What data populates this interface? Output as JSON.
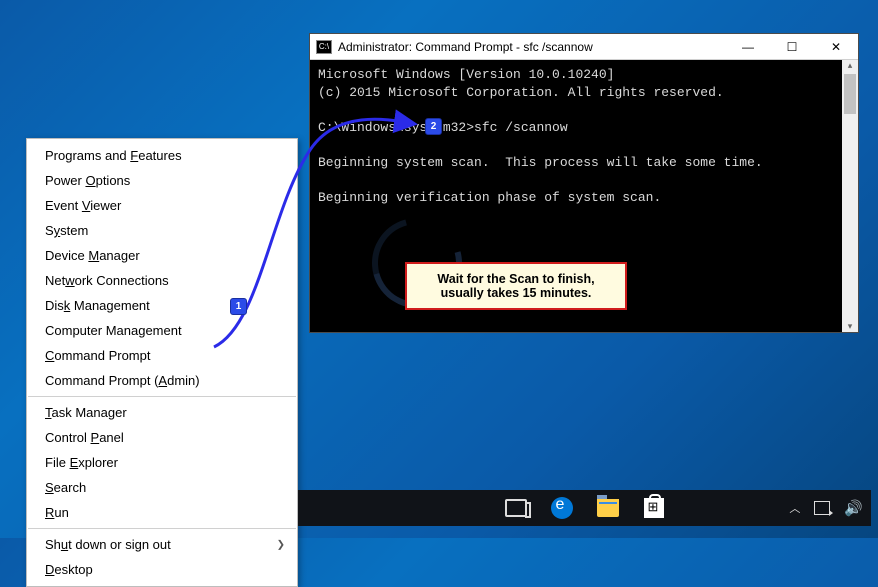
{
  "context_menu": {
    "items": [
      {
        "label_pre": "Programs and ",
        "u": "F",
        "label_post": "eatures"
      },
      {
        "label_pre": "Power ",
        "u": "O",
        "label_post": "ptions"
      },
      {
        "label_pre": "Event ",
        "u": "V",
        "label_post": "iewer"
      },
      {
        "label_pre": "S",
        "u": "y",
        "label_post": "stem"
      },
      {
        "label_pre": "Device ",
        "u": "M",
        "label_post": "anager"
      },
      {
        "label_pre": "Net",
        "u": "w",
        "label_post": "ork Connections"
      },
      {
        "label_pre": "Dis",
        "u": "k",
        "label_post": " Management"
      },
      {
        "label_pre": "Computer Mana",
        "u": "g",
        "label_post": "ement"
      },
      {
        "label_pre": "",
        "u": "C",
        "label_post": "ommand Prompt"
      },
      {
        "label_pre": "Command Prompt (",
        "u": "A",
        "label_post": "dmin)"
      }
    ],
    "items2": [
      {
        "label_pre": "",
        "u": "T",
        "label_post": "ask Manager"
      },
      {
        "label_pre": "Control ",
        "u": "P",
        "label_post": "anel"
      },
      {
        "label_pre": "File ",
        "u": "E",
        "label_post": "xplorer"
      },
      {
        "label_pre": "",
        "u": "S",
        "label_post": "earch"
      },
      {
        "label_pre": "",
        "u": "R",
        "label_post": "un"
      }
    ],
    "items3": [
      {
        "label_pre": "Sh",
        "u": "u",
        "label_post": "t down or sign out",
        "arrow": true
      },
      {
        "label_pre": "",
        "u": "D",
        "label_post": "esktop"
      }
    ]
  },
  "cmd": {
    "title": "Administrator: Command Prompt - sfc  /scannow",
    "line1": "Microsoft Windows [Version 10.0.10240]",
    "line2": "(c) 2015 Microsoft Corporation. All rights reserved.",
    "prompt": "C:\\Windows\\system32>",
    "command": "sfc /scannow",
    "line3": "Beginning system scan.  This process will take some time.",
    "line4": "Beginning verification phase of system scan."
  },
  "callout": {
    "line1": "Wait for the Scan to finish,",
    "line2": "usually takes 15 minutes."
  },
  "steps": {
    "one": "1",
    "two": "2"
  }
}
